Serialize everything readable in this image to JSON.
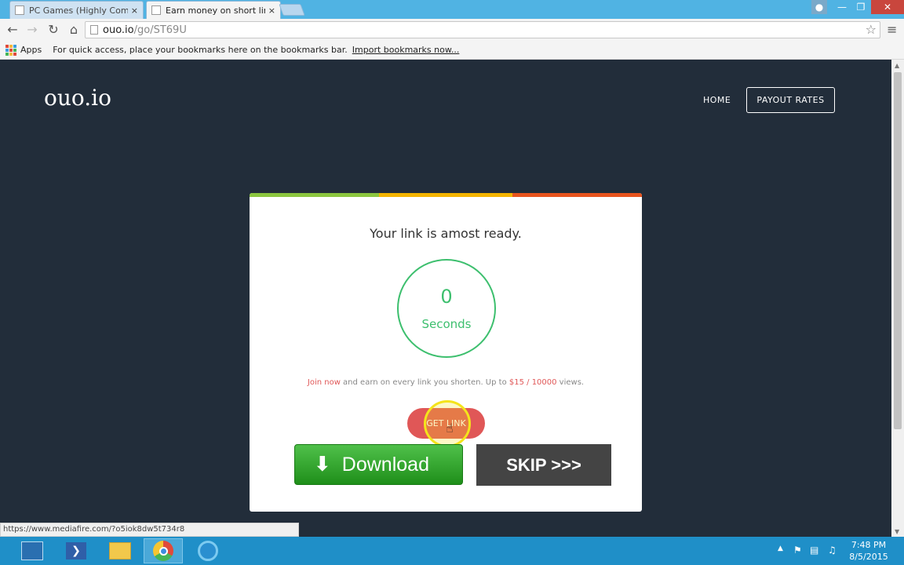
{
  "browser": {
    "tabs": [
      {
        "title": "PC Games (Highly Compr",
        "close": "×"
      },
      {
        "title": "Earn money on short links",
        "close": "×"
      }
    ],
    "url_domain": "ouo.io",
    "url_path": "/go/ST69U",
    "bookmarks": {
      "apps": "Apps",
      "hint": "For quick access, place your bookmarks here on the bookmarks bar.",
      "import": "Import bookmarks now..."
    },
    "status_url": "https://www.mediafire.com/?o5iok8dw5t734r8"
  },
  "site": {
    "logo": "ouo.io",
    "nav": {
      "home": "HOME",
      "payout": "PAYOUT RATES"
    },
    "card": {
      "heading": "Your link is amost ready.",
      "timer_count": "0",
      "timer_unit": "Seconds",
      "promo_join": "Join now",
      "promo_mid": " and earn on every link you shorten. Up to ",
      "promo_rate": "$15 / 10000",
      "promo_end": " views.",
      "get_link": "GET LINK"
    },
    "ads": {
      "download": "Download",
      "skip": "SKIP >>>"
    }
  },
  "taskbar": {
    "time": "7:48 PM",
    "date": "8/5/2015"
  },
  "colors": {
    "page_bg": "#222d3a",
    "accent_green": "#3dbf6e",
    "accent_red": "#e05757",
    "bar_green": "#8cc63f",
    "bar_yellow": "#f4b400",
    "bar_orange": "#e8541e"
  }
}
